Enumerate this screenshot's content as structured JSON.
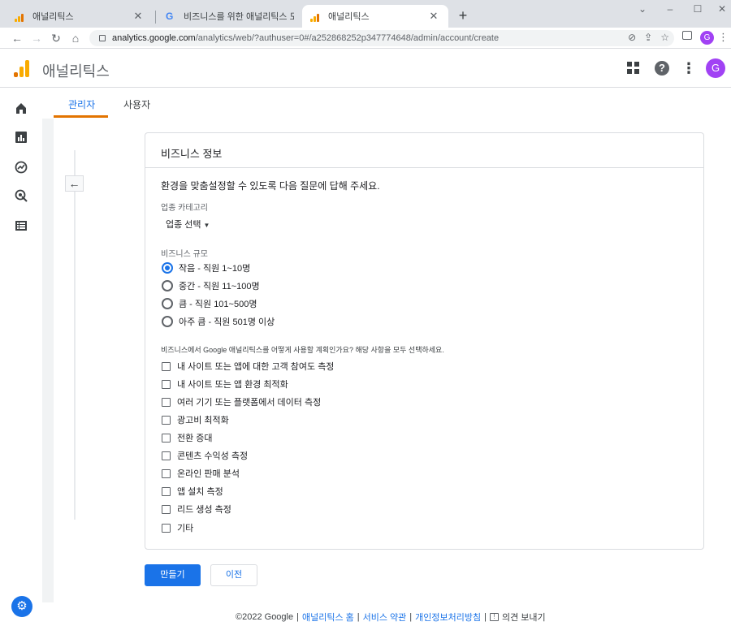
{
  "browser": {
    "tabs": [
      {
        "title": "애널리틱스",
        "icon": "analytics-icon"
      },
      {
        "title": "비즈니스를 위한 애널리틱스 도구",
        "icon": "google-icon"
      },
      {
        "title": "애널리틱스",
        "icon": "analytics-icon"
      }
    ],
    "close_glyph": "✕",
    "new_tab_glyph": "+",
    "window_controls": [
      "⌄",
      "–",
      "☐",
      "✕"
    ],
    "url_host": "analytics.google.com",
    "url_path": "/analytics/web/?authuser=0#/a252868252p347774648/admin/account/create",
    "profile_initial": "G"
  },
  "app": {
    "title": "애널리틱스",
    "avatar_initial": "G",
    "help_glyph": "?"
  },
  "admin_tabs": {
    "admin": "관리자",
    "users": "사용자"
  },
  "card": {
    "title": "비즈니스 정보",
    "intro": "환경을 맞춤설정할 수 있도록 다음 질문에 답해 주세요.",
    "industry_label": "업종 카테고리",
    "industry_value": "업종 선택",
    "size_label": "비즈니스 규모",
    "size_options": [
      {
        "label": "작음 - 직원 1~10명",
        "checked": true
      },
      {
        "label": "중간 - 직원 11~100명",
        "checked": false
      },
      {
        "label": "큼 - 직원 101~500명",
        "checked": false
      },
      {
        "label": "아주 큼 - 직원 501명 이상",
        "checked": false
      }
    ],
    "usage_question": "비즈니스에서 Google 애널리틱스를 어떻게 사용할 계획인가요? 해당 사항을 모두 선택하세요.",
    "usage_options": [
      "내 사이트 또는 앱에 대한 고객 참여도 측정",
      "내 사이트 또는 앱 환경 최적화",
      "여러 기기 또는 플랫폼에서 데이터 측정",
      "광고비 최적화",
      "전환 증대",
      "콘텐츠 수익성 측정",
      "온라인 판매 분석",
      "앱 설치 측정",
      "리드 생성 측정",
      "기타"
    ]
  },
  "actions": {
    "create": "만들기",
    "previous": "이전"
  },
  "footer": {
    "copyright": "©2022 Google",
    "sep": "|",
    "home": "애널리틱스 홈",
    "terms": "서비스 약관",
    "privacy": "개인정보처리방침",
    "feedback": "의견 보내기"
  },
  "colors": {
    "accent": "#1a73e8",
    "tab_indicator": "#e37400",
    "logo_light": "#f9ab00",
    "logo_dark": "#e37400"
  }
}
